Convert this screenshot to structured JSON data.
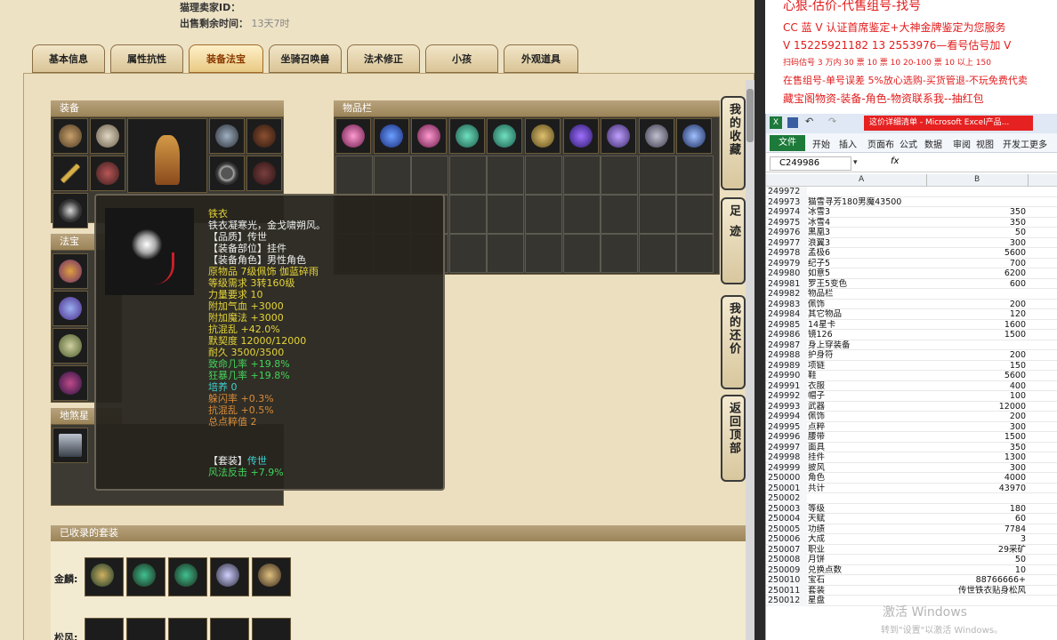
{
  "game": {
    "seller_label": "猫理卖家ID：",
    "time_left_label": "出售剩余时间：",
    "time_left_value": "13天7时",
    "tabs": [
      "基本信息",
      "属性抗性",
      "装备法宝",
      "坐骑召唤兽",
      "法术修正",
      "小孩",
      "外观道具"
    ],
    "active_tab": "装备法宝",
    "equip_title": "装备",
    "inventory_title": "物品栏",
    "fabao_title": "法宝",
    "disha_title": "地煞星",
    "suits_title": "已收录的套装",
    "suit_rows": [
      "金麟:",
      "松风:"
    ],
    "side_buttons": [
      "我的收藏",
      "足迹",
      "我的还价",
      "返回顶部"
    ]
  },
  "tooltip": {
    "name": "铁衣",
    "desc": "铁衣凝寒光，金戈啸朔风。",
    "quality": "【品质】传世",
    "slot": "【装备部位】挂件",
    "role": "【装备角色】男性角色",
    "origin": "原物品 7级佩饰 伽蓝碎雨",
    "level": "等级需求 3转160级",
    "power": "力量要求 10",
    "hp": "附加气血 +3000",
    "mp": "附加魔法 +3000",
    "resist": "抗混乱 +42.0%",
    "tacit": "默契度 12000/12000",
    "durability": "耐久 3500/3500",
    "crit": "致命几率 +19.8%",
    "rage": "狂暴几率 +19.8%",
    "train": "培养 0",
    "dodge": "躲闪率 +0.3%",
    "resist2": "抗混乱 +0.5%",
    "score": "总点粹值    2",
    "set_label": "【套装】",
    "set_value": "传世",
    "set_bonus": "风法反击 +7.9%"
  },
  "ad": {
    "line1": "心狠-估价-代售组号-找号",
    "line2": "CC 蓝 V 认证首席鉴定+大神金牌鉴定为您服务",
    "line3": "V 15225921182        13 2553976—看号估号加 V",
    "line4": "扫码估号 3 万内 30 票 10 票 10 20-100 票 10 以上 150",
    "line5": "在售组号-单号误差 5%放心选购-买货管退-不玩免费代卖",
    "line6": "藏宝阁物资-装备-角色-物资联系我--抽红包"
  },
  "excel": {
    "title": "这价详细清单 - Microsoft Excel产品...",
    "ribbon_file": "文件",
    "ribbon_tabs": [
      "开始",
      "插入",
      "页面布",
      "公式",
      "数据",
      "审阅",
      "视图",
      "开发工",
      "更多"
    ],
    "namebox": "C249986",
    "fx": "fx",
    "col_a": "A",
    "col_b": "B",
    "rows": [
      {
        "n": "249972",
        "a": "",
        "b": ""
      },
      {
        "n": "249973",
        "a": "猫雪寻芳180男魔43500",
        "b": ""
      },
      {
        "n": "249974",
        "a": "冰雪3",
        "b": "350"
      },
      {
        "n": "249975",
        "a": "冰雪4",
        "b": "350"
      },
      {
        "n": "249976",
        "a": "黑凰3",
        "b": "50"
      },
      {
        "n": "249977",
        "a": "浪翼3",
        "b": "300"
      },
      {
        "n": "249978",
        "a": "孟极6",
        "b": "5600"
      },
      {
        "n": "249979",
        "a": "纪子5",
        "b": "700"
      },
      {
        "n": "249980",
        "a": "如意5",
        "b": "6200"
      },
      {
        "n": "249981",
        "a": "罗王5变色",
        "b": "600"
      },
      {
        "n": "249982",
        "a": "物品栏",
        "b": ""
      },
      {
        "n": "249983",
        "a": "佩饰",
        "b": "200"
      },
      {
        "n": "249984",
        "a": "其它物品",
        "b": "120"
      },
      {
        "n": "249985",
        "a": "14星卡",
        "b": "1600"
      },
      {
        "n": "249986",
        "a": "镜126",
        "b": "1500"
      },
      {
        "n": "249987",
        "a": "身上穿装备",
        "b": ""
      },
      {
        "n": "249988",
        "a": "护身符",
        "b": "200"
      },
      {
        "n": "249989",
        "a": "项链",
        "b": "150"
      },
      {
        "n": "249990",
        "a": "鞋",
        "b": "5600"
      },
      {
        "n": "249991",
        "a": "衣服",
        "b": "400"
      },
      {
        "n": "249992",
        "a": "帽子",
        "b": "100"
      },
      {
        "n": "249993",
        "a": "武器",
        "b": "12000"
      },
      {
        "n": "249994",
        "a": "佩饰",
        "b": "200"
      },
      {
        "n": "249995",
        "a": "点粹",
        "b": "300"
      },
      {
        "n": "249996",
        "a": "腰带",
        "b": "1500"
      },
      {
        "n": "249997",
        "a": "面具",
        "b": "350"
      },
      {
        "n": "249998",
        "a": "挂件",
        "b": "1300"
      },
      {
        "n": "249999",
        "a": "披风",
        "b": "300"
      },
      {
        "n": "250000",
        "a": "角色",
        "b": "4000"
      },
      {
        "n": "250001",
        "a": "共计",
        "b": "43970"
      },
      {
        "n": "250002",
        "a": "",
        "b": ""
      },
      {
        "n": "250003",
        "a": "等级",
        "b": "180"
      },
      {
        "n": "250004",
        "a": "天赋",
        "b": "60"
      },
      {
        "n": "250005",
        "a": "功绩",
        "b": "7784"
      },
      {
        "n": "250006",
        "a": "大成",
        "b": "3"
      },
      {
        "n": "250007",
        "a": "职业",
        "b": "29采矿"
      },
      {
        "n": "250008",
        "a": "月饼",
        "b": "50"
      },
      {
        "n": "250009",
        "a": "兑换点数",
        "b": "10"
      },
      {
        "n": "250010",
        "a": "宝石",
        "b": "88766666+"
      },
      {
        "n": "250011",
        "a": "套装",
        "b": "传世铁衣贴身松风"
      },
      {
        "n": "250012",
        "a": "星盘",
        "b": ""
      }
    ]
  },
  "windows": {
    "watermark": "激活 Windows",
    "watermark_sub": "转到\"设置\"以激活 Windows。"
  },
  "colors": {
    "tooltip_yellow": "#e5d43a",
    "tooltip_green": "#44d35b",
    "tooltip_orange": "#d98c3a",
    "ad_red": "#e21c1c",
    "excel_green": "#1d7a3a"
  }
}
